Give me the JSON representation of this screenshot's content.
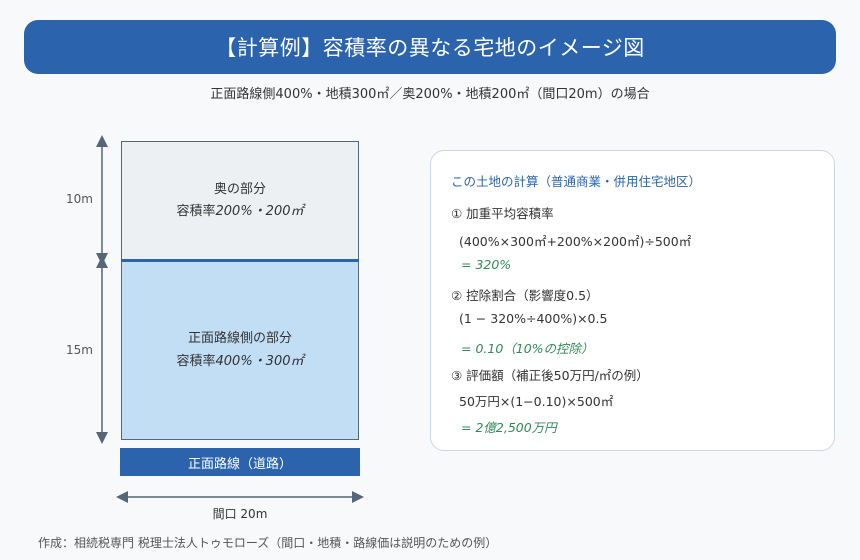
{
  "title": "【計算例】容積率の異なる宅地のイメージ図",
  "subtitle": "正面路線側400%・地積300㎡／奥200%・地積200㎡（間口20m）の場合",
  "diagram": {
    "depth_back": "10m",
    "depth_front": "15m",
    "back_area": {
      "name": "奥の部分",
      "ratio_prefix": "容積率",
      "ratio_value": "200%・200㎡"
    },
    "front_area": {
      "name": "正面路線側の部分",
      "ratio_prefix": "容積率",
      "ratio_value": "400%・300㎡"
    },
    "road": "正面路線（道路）",
    "frontage": "間口 20m"
  },
  "calc": {
    "heading": "この土地の計算（普通商業・併用住宅地区）",
    "step1_title": "① 加重平均容積率",
    "step1_formula": "(400%×300㎡+200%×200㎡)÷500㎡",
    "step1_result": "= 320%",
    "step2_title": "② 控除割合（影響度0.5）",
    "step2_formula": "(1 − 320%÷400%)×0.5",
    "step2_result": "= 0.10（10%の控除）",
    "step3_title": "③ 評価額（補正後50万円/㎡の例）",
    "step3_formula": "50万円×(1−0.10)×500㎡",
    "step3_result": "= 2億2,500万円"
  },
  "footer": "作成：相続税専門 税理士法人トゥモローズ（間口・地積・路線価は説明のための例）",
  "colors": {
    "accent": "#2b63ad",
    "front_fill": "#c2def5",
    "back_fill": "#edf0f3",
    "result": "#2e8b57"
  }
}
